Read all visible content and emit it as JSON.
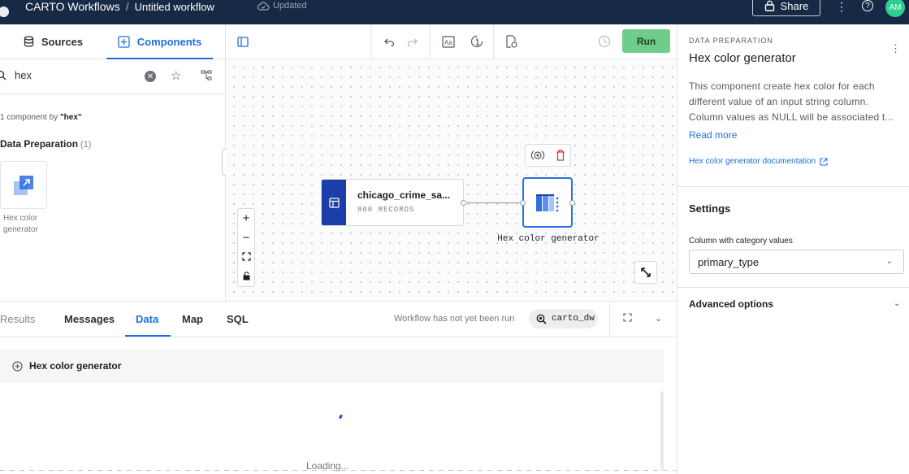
{
  "topbar": {
    "app_title": "CARTO Workflows",
    "separator": "/",
    "workflow_name": "Untitled workflow",
    "status": "Updated",
    "share_label": "Share",
    "avatar_initials": "AM"
  },
  "left_panel": {
    "tabs": [
      {
        "label": "Sources",
        "icon": "database-icon",
        "active": false
      },
      {
        "label": "Components",
        "icon": "component-icon",
        "active": true
      }
    ],
    "search": {
      "value": "hex",
      "placeholder": ""
    },
    "result_count_prefix": "1 component by ",
    "result_count_query": "\"hex\"",
    "category": {
      "name": "Data Preparation",
      "count": "(1)"
    },
    "components": [
      {
        "label": "Hex color generator",
        "icon": "hex-color-generator-icon"
      }
    ]
  },
  "toolbar": {
    "run_label": "Run"
  },
  "canvas": {
    "source_node": {
      "name": "chicago_crime_sa...",
      "records": "800 RECORDS"
    },
    "hex_node": {
      "label": "Hex color generator"
    },
    "zoom_in": "+",
    "zoom_out": "−"
  },
  "bottom_panel": {
    "tabs": [
      {
        "label": "Results",
        "state": "dim"
      },
      {
        "label": "Messages",
        "state": "normal"
      },
      {
        "label": "Data",
        "state": "active"
      },
      {
        "label": "Map",
        "state": "normal"
      },
      {
        "label": "SQL",
        "state": "normal"
      }
    ],
    "run_status": "Workflow has not yet been run",
    "connection": "carto_dw",
    "result_title": "Hex color generator",
    "loading": "Loading..."
  },
  "right_panel": {
    "category": "DATA PREPARATION",
    "title": "Hex color generator",
    "description_lines": [
      "This component create hex color for each",
      "different value of an input string column.",
      "Column values as NULL will be associated t..."
    ],
    "read_more": "Read more",
    "doc_link": "Hex color generator documentation",
    "settings_heading": "Settings",
    "field_label": "Column with category values",
    "field_value": "primary_type",
    "advanced_heading": "Advanced options"
  },
  "colors": {
    "topbar": "#162945",
    "accent": "#1f6ee0",
    "run": "#6fcd8b",
    "avatar": "#2bcf8e",
    "source_node": "#1c3ea8"
  }
}
